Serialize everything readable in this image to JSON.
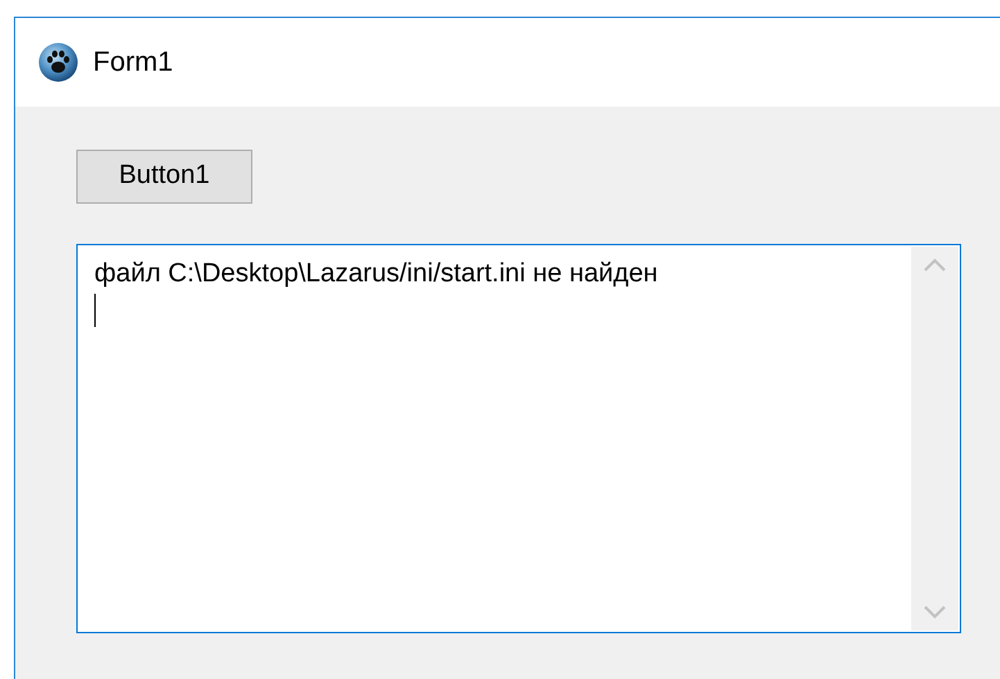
{
  "window": {
    "title": "Form1"
  },
  "button": {
    "label": "Button1"
  },
  "memo": {
    "text": "файл C:\\Desktop\\Lazarus/ini/start.ini не найден",
    "focused": true
  }
}
